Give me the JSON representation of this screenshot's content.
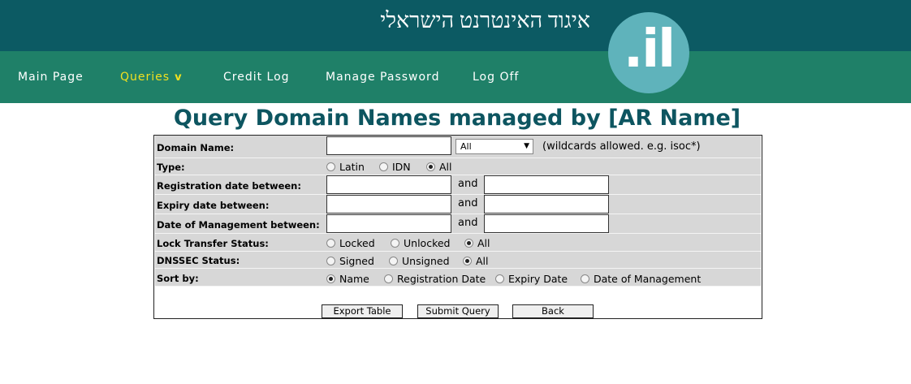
{
  "header": {
    "org_name": "איגוד האינטרנט הישראלי",
    "logo_text": ".il",
    "brand_colors": {
      "top_bar": "#0c5a63",
      "nav_bar": "#1f8068",
      "logo": "#5fb3bb",
      "active_nav": "#f0e020"
    }
  },
  "nav": {
    "main_page": "Main Page",
    "queries": "Queries",
    "queries_chevron": "v",
    "credit_log": "Credit Log",
    "manage_password": "Manage Password",
    "log_off": "Log Off"
  },
  "page_title": "Query Domain Names managed by [AR Name]",
  "form": {
    "domain_name": {
      "label": "Domain Name:",
      "value": "",
      "select_value": "All",
      "hint": "(wildcards allowed. e.g. isoc*)"
    },
    "type": {
      "label": "Type:",
      "options": [
        "Latin",
        "IDN",
        "All"
      ],
      "selected": "All"
    },
    "registration_date": {
      "label": "Registration date between:",
      "from": "",
      "to": "",
      "and": "and"
    },
    "expiry_date": {
      "label": "Expiry date between:",
      "from": "",
      "to": "",
      "and": "and"
    },
    "management_date": {
      "label": "Date of Management between:",
      "from": "",
      "to": "",
      "and": "and"
    },
    "lock_transfer": {
      "label": "Lock Transfer Status:",
      "options": [
        "Locked",
        "Unlocked",
        "All"
      ],
      "selected": "All"
    },
    "dnssec": {
      "label": "DNSSEC Status:",
      "options": [
        "Signed",
        "Unsigned",
        "All"
      ],
      "selected": "All"
    },
    "sort_by": {
      "label": "Sort by:",
      "options": [
        "Name",
        "Registration Date",
        "Expiry Date",
        "Date of Management"
      ],
      "selected": "Name"
    }
  },
  "buttons": {
    "export": "Export Table",
    "submit": "Submit Query",
    "back": "Back"
  }
}
